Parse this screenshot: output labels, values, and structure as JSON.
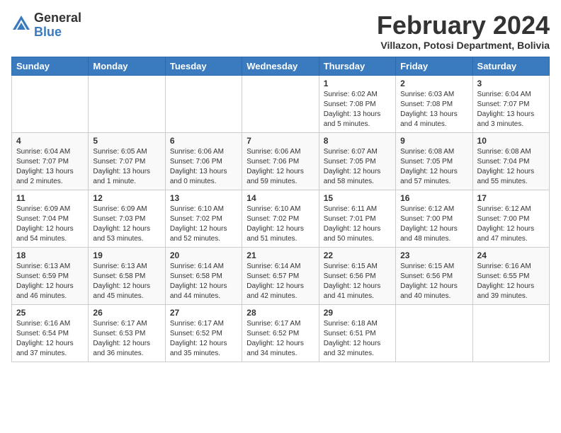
{
  "logo": {
    "general": "General",
    "blue": "Blue"
  },
  "title": {
    "month": "February 2024",
    "location": "Villazon, Potosi Department, Bolivia"
  },
  "weekdays": [
    "Sunday",
    "Monday",
    "Tuesday",
    "Wednesday",
    "Thursday",
    "Friday",
    "Saturday"
  ],
  "weeks": [
    [
      {
        "day": "",
        "info": ""
      },
      {
        "day": "",
        "info": ""
      },
      {
        "day": "",
        "info": ""
      },
      {
        "day": "",
        "info": ""
      },
      {
        "day": "1",
        "info": "Sunrise: 6:02 AM\nSunset: 7:08 PM\nDaylight: 13 hours\nand 5 minutes."
      },
      {
        "day": "2",
        "info": "Sunrise: 6:03 AM\nSunset: 7:08 PM\nDaylight: 13 hours\nand 4 minutes."
      },
      {
        "day": "3",
        "info": "Sunrise: 6:04 AM\nSunset: 7:07 PM\nDaylight: 13 hours\nand 3 minutes."
      }
    ],
    [
      {
        "day": "4",
        "info": "Sunrise: 6:04 AM\nSunset: 7:07 PM\nDaylight: 13 hours\nand 2 minutes."
      },
      {
        "day": "5",
        "info": "Sunrise: 6:05 AM\nSunset: 7:07 PM\nDaylight: 13 hours\nand 1 minute."
      },
      {
        "day": "6",
        "info": "Sunrise: 6:06 AM\nSunset: 7:06 PM\nDaylight: 13 hours\nand 0 minutes."
      },
      {
        "day": "7",
        "info": "Sunrise: 6:06 AM\nSunset: 7:06 PM\nDaylight: 12 hours\nand 59 minutes."
      },
      {
        "day": "8",
        "info": "Sunrise: 6:07 AM\nSunset: 7:05 PM\nDaylight: 12 hours\nand 58 minutes."
      },
      {
        "day": "9",
        "info": "Sunrise: 6:08 AM\nSunset: 7:05 PM\nDaylight: 12 hours\nand 57 minutes."
      },
      {
        "day": "10",
        "info": "Sunrise: 6:08 AM\nSunset: 7:04 PM\nDaylight: 12 hours\nand 55 minutes."
      }
    ],
    [
      {
        "day": "11",
        "info": "Sunrise: 6:09 AM\nSunset: 7:04 PM\nDaylight: 12 hours\nand 54 minutes."
      },
      {
        "day": "12",
        "info": "Sunrise: 6:09 AM\nSunset: 7:03 PM\nDaylight: 12 hours\nand 53 minutes."
      },
      {
        "day": "13",
        "info": "Sunrise: 6:10 AM\nSunset: 7:02 PM\nDaylight: 12 hours\nand 52 minutes."
      },
      {
        "day": "14",
        "info": "Sunrise: 6:10 AM\nSunset: 7:02 PM\nDaylight: 12 hours\nand 51 minutes."
      },
      {
        "day": "15",
        "info": "Sunrise: 6:11 AM\nSunset: 7:01 PM\nDaylight: 12 hours\nand 50 minutes."
      },
      {
        "day": "16",
        "info": "Sunrise: 6:12 AM\nSunset: 7:00 PM\nDaylight: 12 hours\nand 48 minutes."
      },
      {
        "day": "17",
        "info": "Sunrise: 6:12 AM\nSunset: 7:00 PM\nDaylight: 12 hours\nand 47 minutes."
      }
    ],
    [
      {
        "day": "18",
        "info": "Sunrise: 6:13 AM\nSunset: 6:59 PM\nDaylight: 12 hours\nand 46 minutes."
      },
      {
        "day": "19",
        "info": "Sunrise: 6:13 AM\nSunset: 6:58 PM\nDaylight: 12 hours\nand 45 minutes."
      },
      {
        "day": "20",
        "info": "Sunrise: 6:14 AM\nSunset: 6:58 PM\nDaylight: 12 hours\nand 44 minutes."
      },
      {
        "day": "21",
        "info": "Sunrise: 6:14 AM\nSunset: 6:57 PM\nDaylight: 12 hours\nand 42 minutes."
      },
      {
        "day": "22",
        "info": "Sunrise: 6:15 AM\nSunset: 6:56 PM\nDaylight: 12 hours\nand 41 minutes."
      },
      {
        "day": "23",
        "info": "Sunrise: 6:15 AM\nSunset: 6:56 PM\nDaylight: 12 hours\nand 40 minutes."
      },
      {
        "day": "24",
        "info": "Sunrise: 6:16 AM\nSunset: 6:55 PM\nDaylight: 12 hours\nand 39 minutes."
      }
    ],
    [
      {
        "day": "25",
        "info": "Sunrise: 6:16 AM\nSunset: 6:54 PM\nDaylight: 12 hours\nand 37 minutes."
      },
      {
        "day": "26",
        "info": "Sunrise: 6:17 AM\nSunset: 6:53 PM\nDaylight: 12 hours\nand 36 minutes."
      },
      {
        "day": "27",
        "info": "Sunrise: 6:17 AM\nSunset: 6:52 PM\nDaylight: 12 hours\nand 35 minutes."
      },
      {
        "day": "28",
        "info": "Sunrise: 6:17 AM\nSunset: 6:52 PM\nDaylight: 12 hours\nand 34 minutes."
      },
      {
        "day": "29",
        "info": "Sunrise: 6:18 AM\nSunset: 6:51 PM\nDaylight: 12 hours\nand 32 minutes."
      },
      {
        "day": "",
        "info": ""
      },
      {
        "day": "",
        "info": ""
      }
    ]
  ]
}
